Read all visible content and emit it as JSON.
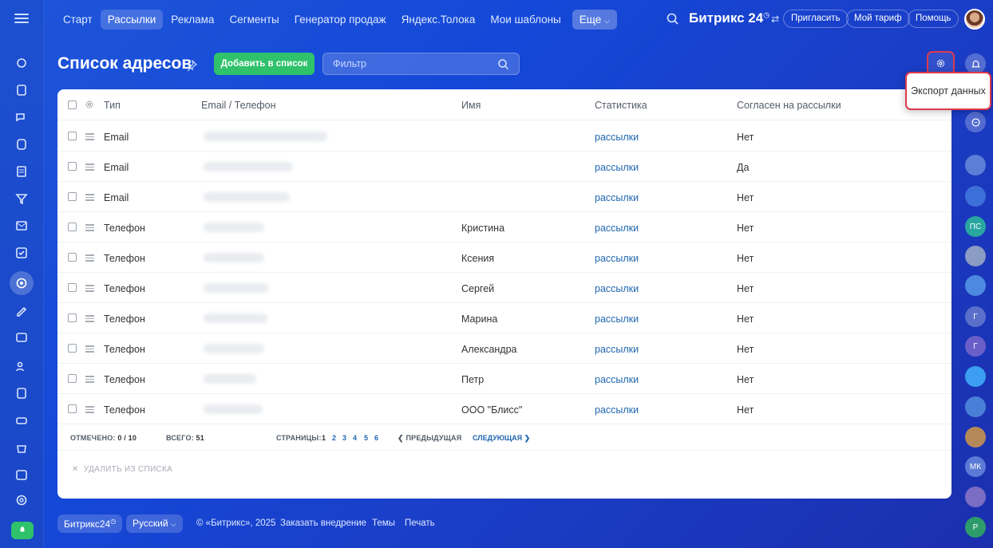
{
  "topnav": {
    "items": [
      "Старт",
      "Рассылки",
      "Реклама",
      "Сегменты",
      "Генератор продаж",
      "Яндекс.Толока",
      "Мои шаблоны"
    ],
    "more": "Еще",
    "brand": "Битрикс 24",
    "invite": "Пригласить",
    "tariff": "Мой тариф",
    "help": "Помощь"
  },
  "page": {
    "title": "Список адресов",
    "add_button": "Добавить в список",
    "filter_placeholder": "Фильтр",
    "export": "Экспорт данных"
  },
  "table": {
    "headers": {
      "type": "Тип",
      "contact": "Email / Телефон",
      "name": "Имя",
      "stats": "Статистика",
      "consent": "Согласен на рассылки"
    },
    "rows": [
      {
        "type": "Email",
        "name": "",
        "stats": "рассылки",
        "consent": "Нет"
      },
      {
        "type": "Email",
        "name": "",
        "stats": "рассылки",
        "consent": "Да"
      },
      {
        "type": "Email",
        "name": "",
        "stats": "рассылки",
        "consent": "Нет"
      },
      {
        "type": "Телефон",
        "name": "Кристина",
        "stats": "рассылки",
        "consent": "Нет"
      },
      {
        "type": "Телефон",
        "name": "Ксения",
        "stats": "рассылки",
        "consent": "Нет"
      },
      {
        "type": "Телефон",
        "name": "Сергей",
        "stats": "рассылки",
        "consent": "Нет"
      },
      {
        "type": "Телефон",
        "name": "Марина",
        "stats": "рассылки",
        "consent": "Нет"
      },
      {
        "type": "Телефон",
        "name": "Александра",
        "stats": "рассылки",
        "consent": "Нет"
      },
      {
        "type": "Телефон",
        "name": "Петр",
        "stats": "рассылки",
        "consent": "Нет"
      },
      {
        "type": "Телефон",
        "name": "ООО \"Блисс\"",
        "stats": "рассылки",
        "consent": "Нет"
      }
    ],
    "footer": {
      "checked_label": "ОТМЕЧЕНО:",
      "checked_value": "0 / 10",
      "total_label": "ВСЕГО:",
      "total_value": "51",
      "pages_label": "СТРАНИЦЫ:",
      "pages": [
        "1",
        "2",
        "3",
        "4",
        "5",
        "6"
      ],
      "prev": "ПРЕДЫДУЩАЯ",
      "next": "СЛЕДУЮЩАЯ"
    },
    "delete_action": "УДАЛИТЬ ИЗ СПИСКА"
  },
  "rightbar": {
    "avatars": [
      "",
      "",
      "ПС",
      "",
      "",
      "Г",
      "Г",
      "",
      "",
      "",
      "МК",
      "",
      "Р"
    ]
  },
  "bottom": {
    "brand": "Битрикс24",
    "language": "Русский",
    "copyright": "© «Битрикс», 2025",
    "order": "Заказать внедрение",
    "themes": "Темы",
    "print": "Печать"
  },
  "colors": {
    "accent_green": "#2fc26b",
    "link_blue": "#2067b0",
    "highlight_red": "#e0394a"
  }
}
